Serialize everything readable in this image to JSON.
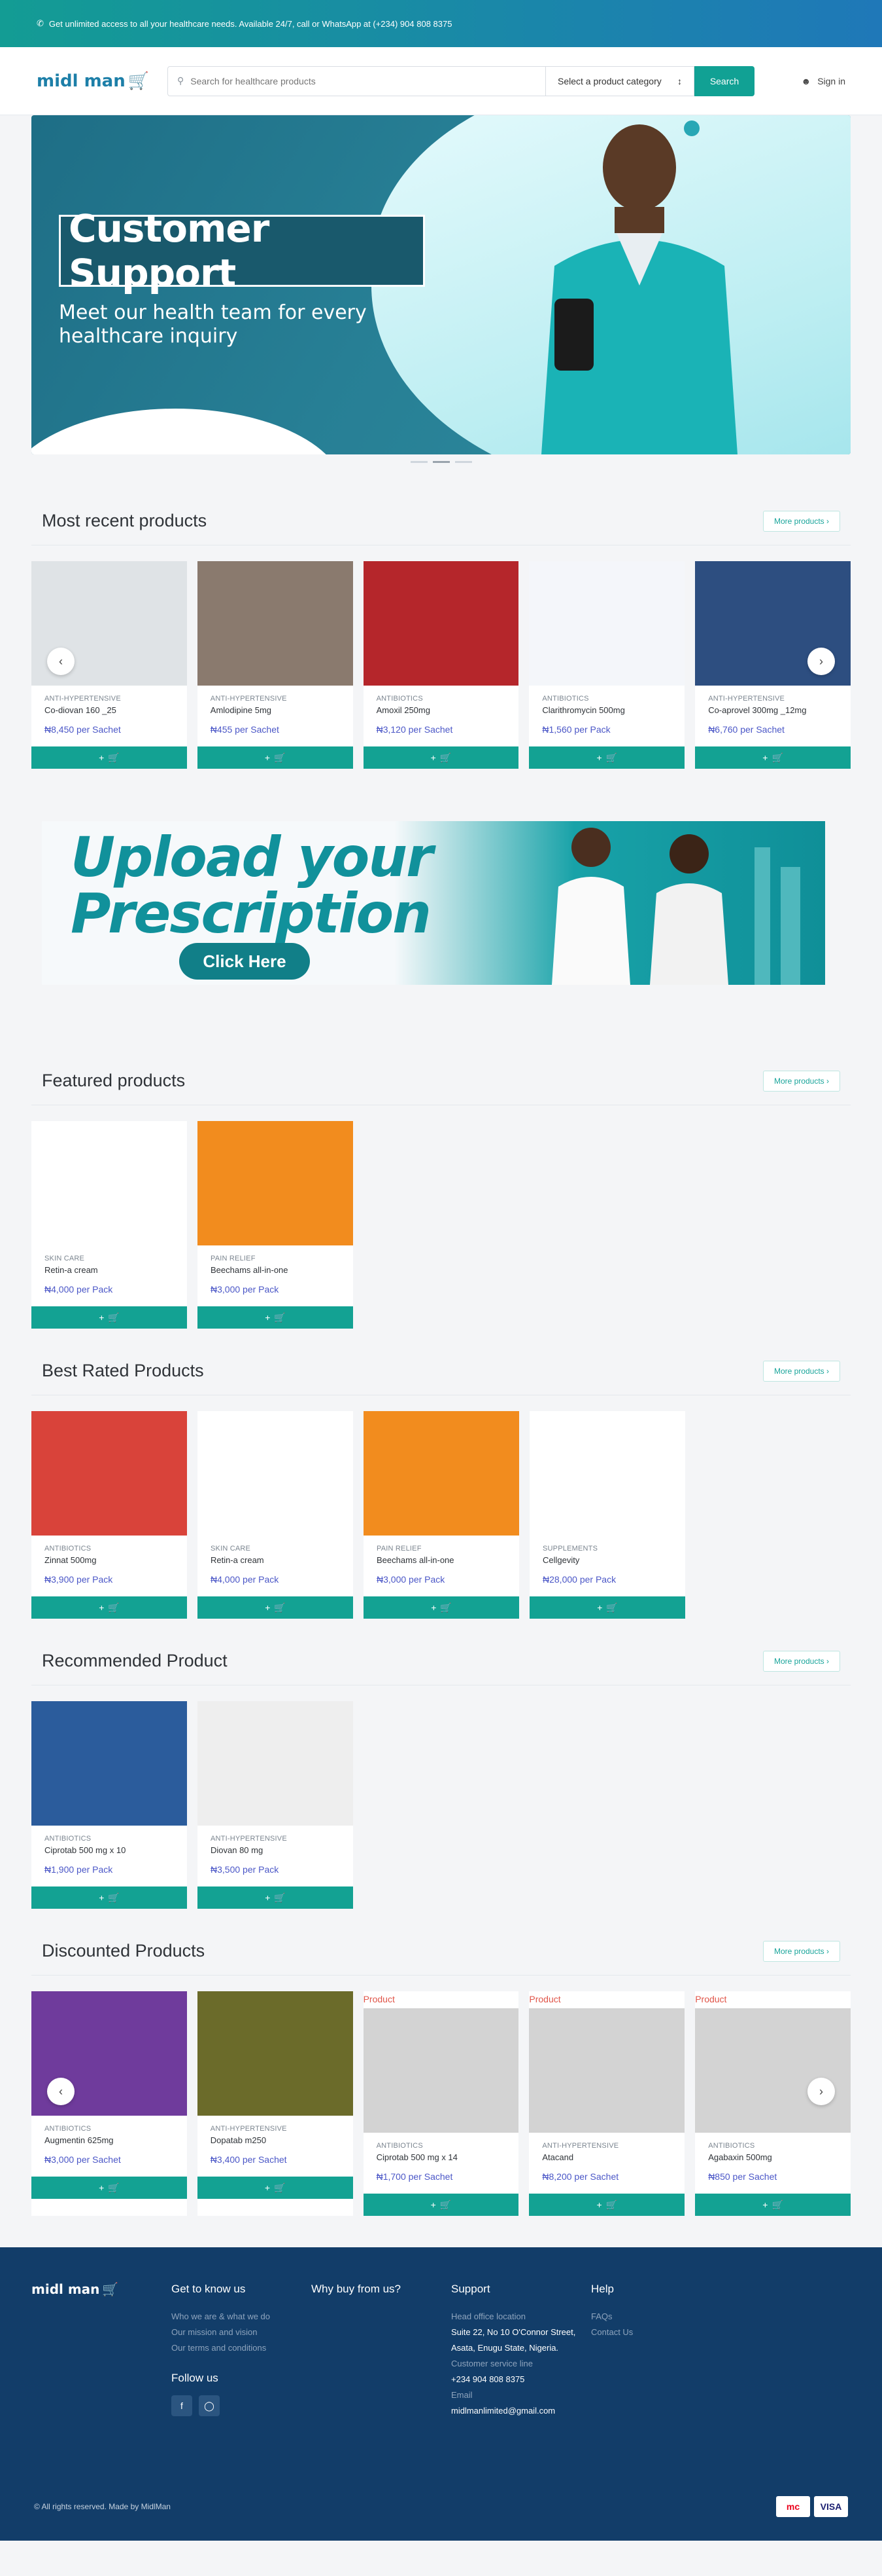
{
  "topbar": {
    "text": "Get unlimited access to all your healthcare needs. Available 24/7, call or WhatsApp at (+234) 904 808 8375"
  },
  "header": {
    "logo": "midl man",
    "search_placeholder": "Search for healthcare products",
    "category_label": "Select a product category",
    "search_button": "Search",
    "signin": "Sign in"
  },
  "hero": {
    "title": "Customer Support",
    "subtitle": "Meet our health team for every healthcare inquiry"
  },
  "upload_banner": {
    "line1": "Upload your",
    "line2": "Prescription",
    "button": "Click Here"
  },
  "sections": {
    "recent": {
      "title": "Most recent products",
      "more": "More products"
    },
    "featured": {
      "title": "Featured products",
      "more": "More products"
    },
    "rated": {
      "title": "Best Rated Products",
      "more": "More products"
    },
    "recommended": {
      "title": "Recommended Product",
      "more": "More products"
    },
    "discounted": {
      "title": "Discounted Products",
      "more": "More products"
    }
  },
  "recent_products": [
    {
      "cat": "ANTI-HYPERTENSIVE",
      "name": "Co-diovan 160 _25",
      "price": "₦8,450 per Sachet"
    },
    {
      "cat": "ANTI-HYPERTENSIVE",
      "name": "Amlodipine 5mg",
      "price": "₦455 per Sachet"
    },
    {
      "cat": "ANTIBIOTICS",
      "name": "Amoxil 250mg",
      "price": "₦3,120 per Sachet"
    },
    {
      "cat": "ANTIBIOTICS",
      "name": "Clarithromycin 500mg",
      "price": "₦1,560 per Pack"
    },
    {
      "cat": "ANTI-HYPERTENSIVE",
      "name": "Co-aprovel 300mg _12mg",
      "price": "₦6,760 per Sachet"
    }
  ],
  "featured_products": [
    {
      "cat": "SKIN CARE",
      "name": "Retin-a cream",
      "price": "₦4,000 per Pack"
    },
    {
      "cat": "PAIN RELIEF",
      "name": "Beechams all-in-one",
      "price": "₦3,000 per Pack"
    }
  ],
  "rated_products": [
    {
      "cat": "ANTIBIOTICS",
      "name": "Zinnat 500mg",
      "price": "₦3,900 per Pack"
    },
    {
      "cat": "SKIN CARE",
      "name": "Retin-a cream",
      "price": "₦4,000 per Pack"
    },
    {
      "cat": "PAIN RELIEF",
      "name": "Beechams all-in-one",
      "price": "₦3,000 per Pack"
    },
    {
      "cat": "SUPPLEMENTS",
      "name": "Cellgevity",
      "price": "₦28,000 per Pack"
    }
  ],
  "recommended_products": [
    {
      "cat": "ANTIBIOTICS",
      "name": "Ciprotab 500 mg x 10",
      "price": "₦1,900 per Pack"
    },
    {
      "cat": "ANTI-HYPERTENSIVE",
      "name": "Diovan 80 mg",
      "price": "₦3,500 per Pack"
    }
  ],
  "discounted_products": [
    {
      "cat": "ANTIBIOTICS",
      "name": "Augmentin 625mg",
      "price": "₦3,000 per Sachet",
      "ribbon": ""
    },
    {
      "cat": "ANTI-HYPERTENSIVE",
      "name": "Dopatab m250",
      "price": "₦3,400 per Sachet",
      "ribbon": ""
    },
    {
      "cat": "ANTIBIOTICS",
      "name": "Ciprotab 500 mg x 14",
      "price": "₦1,700 per Sachet",
      "ribbon": "Product"
    },
    {
      "cat": "ANTI-HYPERTENSIVE",
      "name": "Atacand",
      "price": "₦8,200 per Sachet",
      "ribbon": "Product"
    },
    {
      "cat": "ANTIBIOTICS",
      "name": "Agabaxin 500mg",
      "price": "₦850 per Sachet",
      "ribbon": "Product"
    }
  ],
  "product_images": {
    "recent": [
      "#dfe3e6",
      "#8a7a6e",
      "#b5262b",
      "#f4f6fa",
      "#2d4e80"
    ],
    "featured": [
      "#ffffff",
      "#f28c1e"
    ],
    "rated": [
      "#d9433a",
      "#ffffff",
      "#f28c1e",
      "#ffffff"
    ],
    "recommended": [
      "#2b5c9c",
      "#eeeeee"
    ],
    "discounted": [
      "#6f3b9c",
      "#6b6b2a",
      "#d3d3d3",
      "#d3d3d3",
      "#d3d3d3"
    ]
  },
  "add_to_cart": "+",
  "footer": {
    "logo": "midl man",
    "col1_title": "Get to know us",
    "col1_links": [
      "Who we are & what we do",
      "Our mission and vision",
      "Our terms and conditions"
    ],
    "follow": "Follow us",
    "col2_title": "Why buy from us?",
    "col3_title": "Support",
    "head_office_label": "Head office location",
    "address": "Suite 22, No 10 O'Connor Street, Asata, Enugu State, Nigeria.",
    "service_label": "Customer service line",
    "phone": "+234 904 808 8375",
    "email_label": "Email",
    "email": "midlmanlimited@gmail.com",
    "col4_title": "Help",
    "col4_links": [
      "FAQs",
      "Contact Us"
    ],
    "copyright": "© All rights reserved. Made by MidlMan",
    "pay": [
      "mc",
      "VISA"
    ]
  }
}
